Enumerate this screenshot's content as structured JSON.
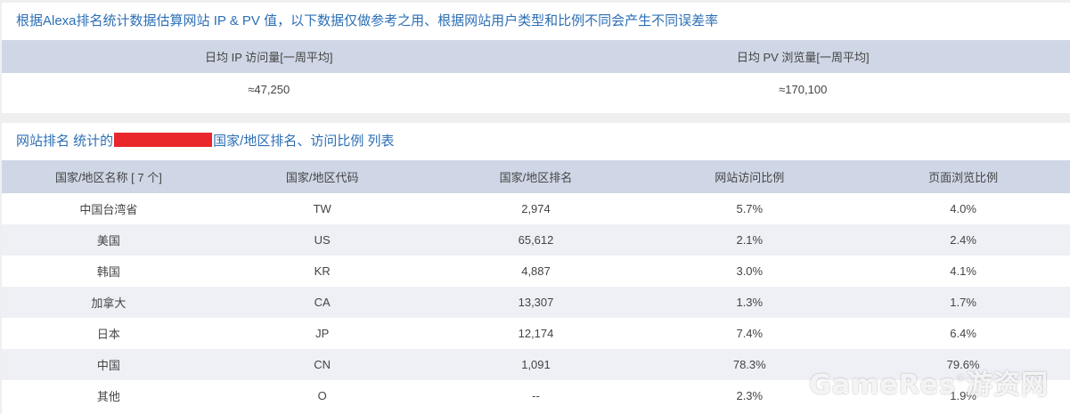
{
  "estimates": {
    "title": "根据Alexa排名统计数据估算网站 IP & PV 值，以下数据仅做参考之用、根据网站用户类型和比例不同会产生不同误差率",
    "headers": [
      "日均 IP 访问量[一周平均]",
      "日均 PV 浏览量[一周平均]"
    ],
    "values": [
      "≈47,250",
      "≈170,100"
    ]
  },
  "ranking": {
    "title_prefix": "网站排名 统计的",
    "title_suffix": "国家/地区排名、访问比例 列表",
    "headers": [
      "国家/地区名称 [ 7 个]",
      "国家/地区代码",
      "国家/地区排名",
      "网站访问比例",
      "页面浏览比例"
    ],
    "rows": [
      [
        "中国台湾省",
        "TW",
        "2,974",
        "5.7%",
        "4.0%"
      ],
      [
        "美国",
        "US",
        "65,612",
        "2.1%",
        "2.4%"
      ],
      [
        "韩国",
        "KR",
        "4,887",
        "3.0%",
        "4.1%"
      ],
      [
        "加拿大",
        "CA",
        "13,307",
        "1.3%",
        "1.7%"
      ],
      [
        "日本",
        "JP",
        "12,174",
        "7.4%",
        "6.4%"
      ],
      [
        "中国",
        "CN",
        "1,091",
        "78.3%",
        "79.6%"
      ],
      [
        "其他",
        "O",
        "--",
        "2.3%",
        "1.9%"
      ]
    ]
  },
  "watermark": {
    "text": "GameRes",
    "registered": "®",
    "suffix": "游资网"
  }
}
